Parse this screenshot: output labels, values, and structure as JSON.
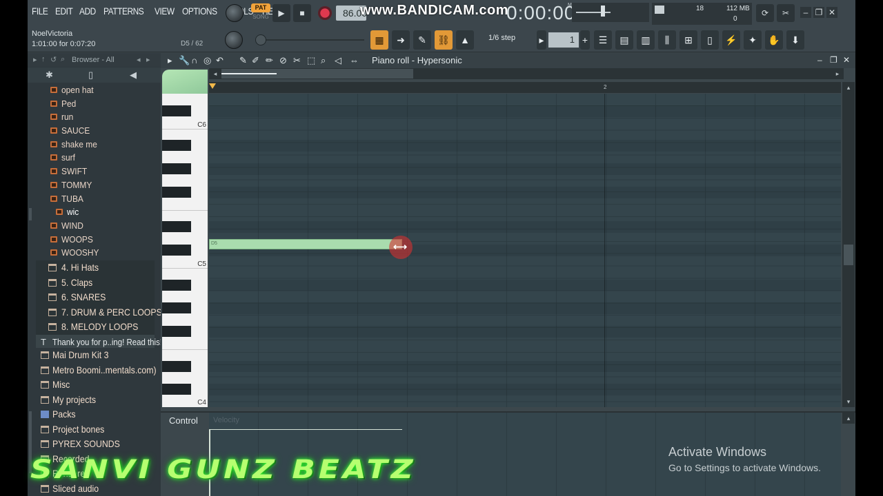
{
  "menu": [
    "FILE",
    "EDIT",
    "ADD",
    "PATTERNS",
    "VIEW",
    "OPTIONS",
    "TOOLS",
    "HELP"
  ],
  "transport": {
    "pat": "PAT",
    "song": "SONG",
    "play": "▶",
    "stop": "■",
    "tempo": "86.00",
    "time": "0:00:00",
    "time_label": "M:S:CS"
  },
  "watermark": "www.BANDICAM.com",
  "cpu": {
    "voices": "18",
    "memory": "112 MB",
    "polyphony": "0"
  },
  "info": {
    "user": "NoelVictoria",
    "hint": "1:01:00 for 0:07:20",
    "counter": "D5 / 62"
  },
  "snap": {
    "label": "1/6 step",
    "value": "1"
  },
  "browser": {
    "title": "Browser - All",
    "items": [
      {
        "label": "open hat"
      },
      {
        "label": "Ped"
      },
      {
        "label": "run"
      },
      {
        "label": "SAUCE"
      },
      {
        "label": "shake me"
      },
      {
        "label": "surf"
      },
      {
        "label": "SWIFT"
      },
      {
        "label": "TOMMY"
      },
      {
        "label": "TUBA"
      },
      {
        "label": "wic"
      },
      {
        "label": "WIND"
      },
      {
        "label": "WOOPS"
      },
      {
        "label": "WOOSHY"
      }
    ],
    "subfolders": [
      {
        "label": "4. Hi Hats"
      },
      {
        "label": "5. Claps"
      },
      {
        "label": "6. SNARES"
      },
      {
        "label": "7. DRUM & PERC LOOPS"
      },
      {
        "label": "8. MELODY LOOPS"
      }
    ],
    "textfile": "Thank you for p..ing! Read this!",
    "folders": [
      {
        "label": "Mai Drum Kit 3"
      },
      {
        "label": "Metro Boomi..mentals.com)"
      },
      {
        "label": "Misc"
      },
      {
        "label": "My projects"
      },
      {
        "label": "Packs"
      },
      {
        "label": "Project bones"
      },
      {
        "label": "PYREX SOUNDS"
      },
      {
        "label": "Recorded"
      },
      {
        "label": "Rendered"
      },
      {
        "label": "Sliced audio"
      }
    ]
  },
  "piano_roll": {
    "title": "Piano roll - Hypersonic",
    "bar_number": "2",
    "key_labels": [
      "C6",
      "C5",
      "C4"
    ],
    "note_label": "D5",
    "control_label": "Control",
    "control_param": "Velocity"
  },
  "overlay": {
    "activate_title": "Activate Windows",
    "activate_sub": "Go to Settings to activate Windows.",
    "brand": "SANVI GUNZ BEATZ"
  }
}
